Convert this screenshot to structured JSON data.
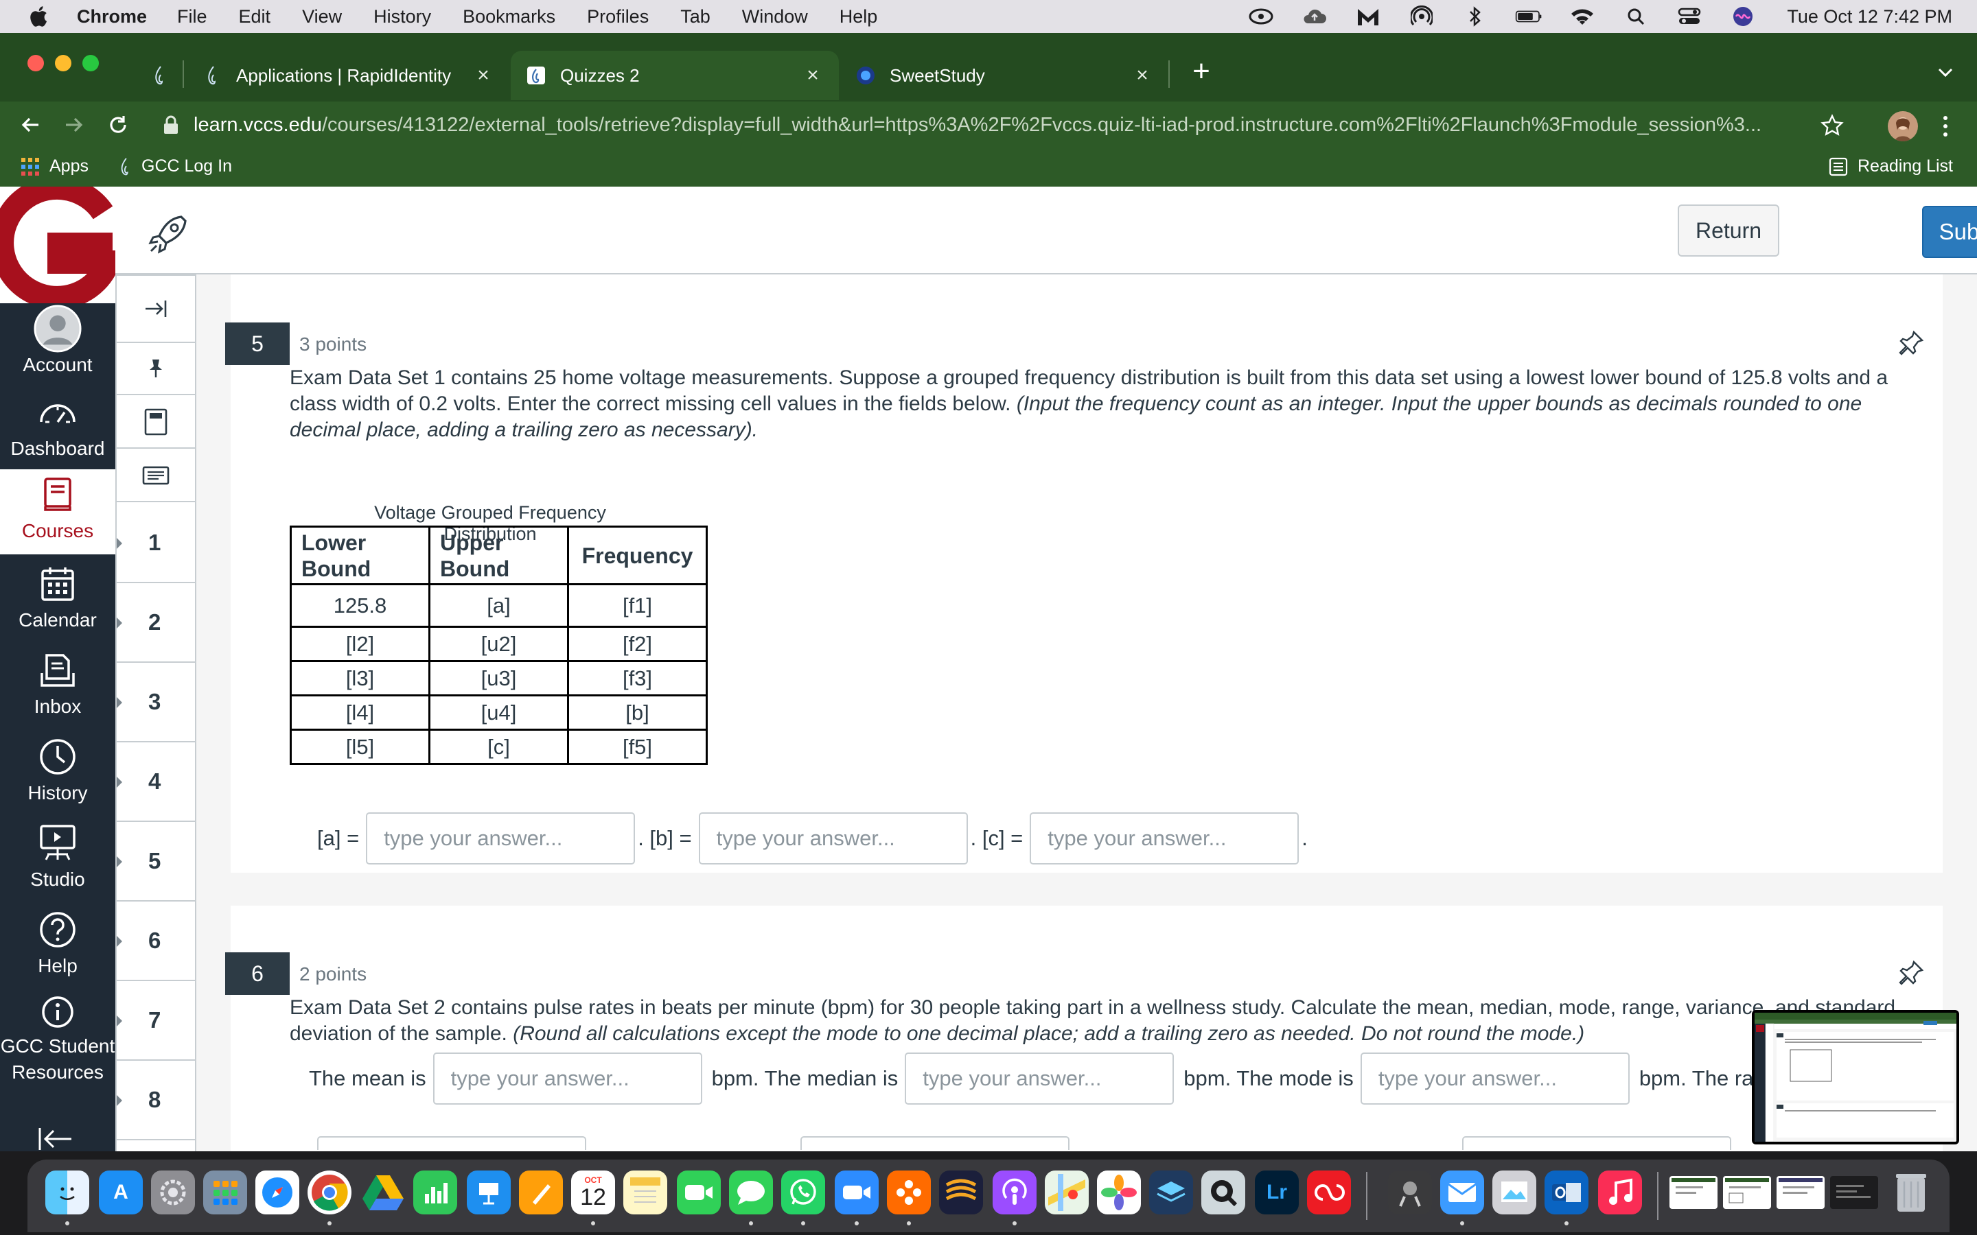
{
  "menubar": {
    "app_name": "Chrome",
    "items": [
      "File",
      "Edit",
      "View",
      "History",
      "Bookmarks",
      "Profiles",
      "Tab",
      "Window",
      "Help"
    ],
    "clock": "Tue Oct 12  7:42 PM"
  },
  "browser": {
    "tabs": [
      {
        "title": "Applications | RapidIdentity",
        "close": "×"
      },
      {
        "title": "Quizzes 2",
        "close": "×"
      },
      {
        "title": "SweetStudy",
        "close": "×"
      }
    ],
    "new_tab": "+",
    "url_host": "learn.vccs.edu",
    "url_path": "/courses/413122/external_tools/retrieve?display=full_width&url=https%3A%2F%2Fvccs.quiz-lti-iad-prod.instructure.com%2Flti%2Flaunch%3Fmodule_session%3...",
    "bookmarks": {
      "apps": "Apps",
      "gcc": "GCC Log In",
      "reading_list": "Reading List"
    }
  },
  "global_nav": {
    "items": [
      {
        "label": "Account"
      },
      {
        "label": "Dashboard"
      },
      {
        "label": "Courses"
      },
      {
        "label": "Calendar"
      },
      {
        "label": "Inbox"
      },
      {
        "label": "History"
      },
      {
        "label": "Studio"
      },
      {
        "label": "Help"
      },
      {
        "label": "GCC Student Resources"
      }
    ]
  },
  "topbar": {
    "return_label": "Return",
    "submit_label": "Submit"
  },
  "question_nav": [
    "1",
    "2",
    "3",
    "4",
    "5",
    "6",
    "7",
    "8"
  ],
  "questions": {
    "q5": {
      "number": "5",
      "points": "3 points",
      "text": "Exam Data Set 1 contains 25 home voltage measurements. Suppose a grouped frequency distribution is built from this data set using a lowest lower bound of 125.8 volts and a class width of 0.2 volts. Enter the correct missing cell values in the fields below. ",
      "instruction": "(Input the frequency count as an integer. Input the upper bounds as decimals rounded to one decimal place, adding a trailing zero as necessary).",
      "table": {
        "caption": "Voltage Grouped Frequency Distribution",
        "headers": [
          "Lower Bound",
          "Upper Bound",
          "Frequency"
        ],
        "rows": [
          [
            "125.8",
            "[a]",
            "[f1]"
          ],
          [
            "[l2]",
            "[u2]",
            "[f2]"
          ],
          [
            "[l3]",
            "[u3]",
            "[f3]"
          ],
          [
            "[l4]",
            "[u4]",
            "[b]"
          ],
          [
            "[l5]",
            "[c]",
            "[f5]"
          ]
        ]
      },
      "answers": {
        "a_label": "[a] =",
        "b_label": ". [b] =",
        "c_label": ". [c] =",
        "end": ".",
        "placeholder": "type your answer..."
      }
    },
    "q6": {
      "number": "6",
      "points": "2 points",
      "text": "Exam Data Set 2 contains pulse rates in beats per minute (bpm) for 30 people taking part in a wellness study. Calculate the mean, median, mode, range, variance, and standard deviation of the sample. ",
      "instruction": "(Round all calculations except the mode to one decimal place; add a trailing zero as needed. Do not round the mode.)",
      "answers": {
        "mean_label": "The mean is",
        "median_label": "bpm. The median is",
        "mode_label": "bpm. The mode is",
        "range_label": "bpm. The ra",
        "placeholder": "type your answer..."
      }
    }
  },
  "dock": {
    "calendar_month": "OCT",
    "calendar_day": "12",
    "lightroom": "Lr"
  },
  "colors": {
    "canvas_nav": "#1f2a36",
    "canvas_red": "#a7101d",
    "submit_blue": "#2b7abc",
    "chrome_green": "#2d5a27"
  }
}
